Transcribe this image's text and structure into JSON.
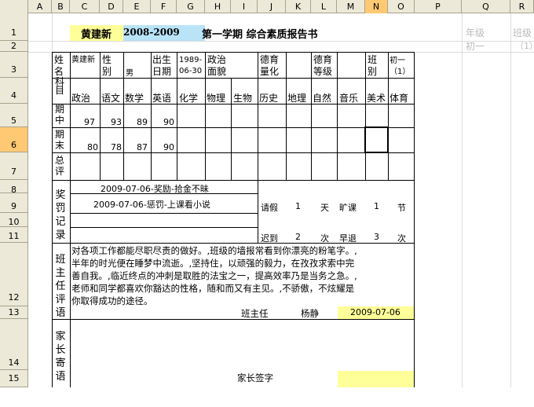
{
  "columns": [
    "A",
    "B",
    "C",
    "D",
    "E",
    "F",
    "G",
    "H",
    "I",
    "J",
    "K",
    "L",
    "M",
    "N",
    "O",
    "P",
    "Q",
    "R"
  ],
  "rows": [
    "1",
    "2",
    "3",
    "4",
    "5",
    "6",
    "7",
    "8",
    "9",
    "10",
    "11",
    "12",
    "13",
    "14",
    "15"
  ],
  "title": {
    "name": "黄建新",
    "year": "2008-2009",
    "rest": "第一学期 综合素质报告书"
  },
  "side": {
    "grade_label": "年级",
    "grade_value": "初一",
    "class_label": "班级",
    "class_value": "（1）"
  },
  "info": {
    "name_label": "姓名",
    "name_value": "黄建新",
    "sex_label": "性别",
    "sex_value": "男",
    "birth_label": "出生日期",
    "birth_value": "1989-06-30",
    "politics_label": "政治面貌",
    "moral_q_label": "德育量化",
    "moral_g_label": "德育等级",
    "class_label": "班别",
    "class_value": "初一（1）"
  },
  "subjects_label": "科目",
  "subjects": [
    "政治",
    "语文",
    "数学",
    "英语",
    "化学",
    "物理",
    "生物",
    "历史",
    "地理",
    "自然",
    "音乐",
    "美术",
    "体育"
  ],
  "midterm": {
    "label": "期中",
    "scores": [
      "97",
      "93",
      "89",
      "90"
    ]
  },
  "final": {
    "label": "期末",
    "scores": [
      "80",
      "78",
      "87",
      "90"
    ]
  },
  "total_label": "总评",
  "rewards": {
    "label": "奖罚记录",
    "items": [
      "2009-07-06-奖励-拾金不昧",
      "2009-07-06-惩罚-上课看小说"
    ]
  },
  "attendance": {
    "leave": "请假",
    "leave_n": "1",
    "day": "天",
    "skip": "旷课",
    "skip_n": "1",
    "period": "节",
    "late": "迟到",
    "late_n": "2",
    "times": "次",
    "early": "早退",
    "early_n": "3",
    "times2": "次"
  },
  "teacher_comment": {
    "label": "班主任评语",
    "lines": [
      "对各项工作都能尽职尽责的做好。,班级的墙报常看到你漂亮的粉笔字。,",
      "半年的时光便在睡梦中流逝。,坚持住，以顽强的毅力，在孜孜求索中完",
      "善自我。,临近终点的冲刺是取胜的法宝之一，提高效率乃是当务之急。,",
      "老师和同学都喜欢你豁达的性格，随和而又有主见。,不骄傲，不炫耀是",
      "你取得成功的途径。"
    ],
    "sign_label": "班主任",
    "teacher": "杨静",
    "date": "2009-07-06"
  },
  "parent": {
    "label": "家长寄语",
    "sign_label": "家长签字"
  }
}
